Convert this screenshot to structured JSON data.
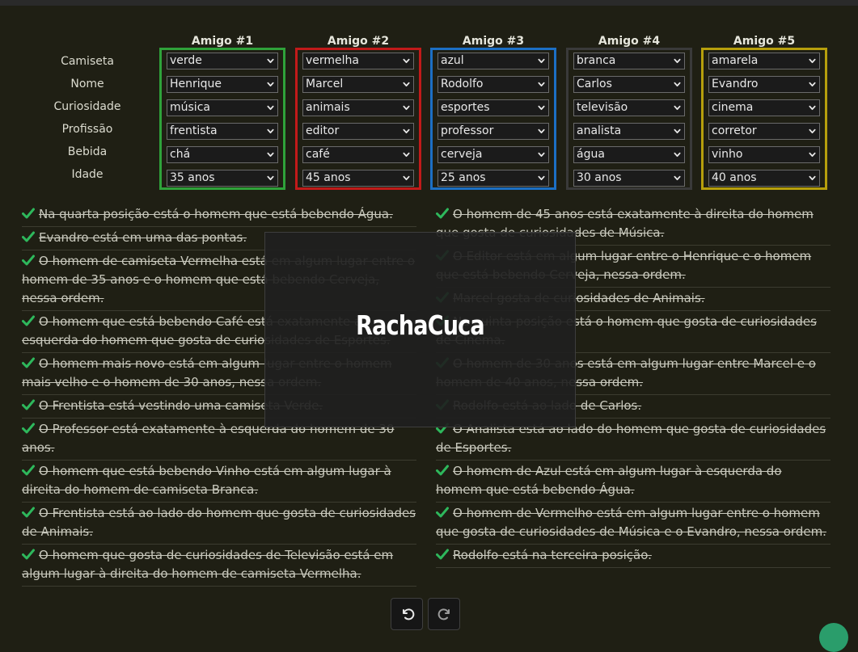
{
  "rows": [
    "Camiseta",
    "Nome",
    "Curiosidade",
    "Profissão",
    "Bebida",
    "Idade"
  ],
  "columns": [
    {
      "title": "Amigo #1",
      "color": "#2fa23a",
      "values": [
        "verde",
        "Henrique",
        "música",
        "frentista",
        "chá",
        "35 anos"
      ]
    },
    {
      "title": "Amigo #2",
      "color": "#c11a1a",
      "values": [
        "vermelha",
        "Marcel",
        "animais",
        "editor",
        "café",
        "45 anos"
      ]
    },
    {
      "title": "Amigo #3",
      "color": "#1c6fc4",
      "values": [
        "azul",
        "Rodolfo",
        "esportes",
        "professor",
        "cerveja",
        "25 anos"
      ]
    },
    {
      "title": "Amigo #4",
      "color": "#3a3a3a",
      "values": [
        "branca",
        "Carlos",
        "televisão",
        "analista",
        "água",
        "30 anos"
      ]
    },
    {
      "title": "Amigo #5",
      "color": "#b69f0c",
      "values": [
        "amarela",
        "Evandro",
        "cinema",
        "corretor",
        "vinho",
        "40 anos"
      ]
    }
  ],
  "clues_left": [
    "Na quarta posição está o homem que está bebendo Água.",
    "Evandro está em uma das pontas.",
    "O homem de camiseta Vermelha está em algum lugar entre o homem de 35 anos e o homem que está bebendo Cerveja, nessa ordem.",
    "O homem que está bebendo Café está exatamente à esquerda do homem que gosta de curiosidades de Esportes.",
    "O homem mais novo está em algum lugar entre o homem mais velho e o homem de 30 anos, nessa ordem.",
    "O Frentista está vestindo uma camiseta Verde.",
    "O Professor está exatamente à esquerda do homem de 30 anos.",
    "O homem que está bebendo Vinho está em algum lugar à direita do homem de camiseta Branca.",
    "O Frentista está ao lado do homem que gosta de curiosidades de Animais.",
    "O homem que gosta de curiosidades de Televisão está em algum lugar à direita do homem de camiseta Vermelha."
  ],
  "clues_right": [
    "O homem de 45 anos está exatamente à direita do homem que gosta de curiosidades de Música.",
    "O Editor está em algum lugar entre o Henrique e o homem que está bebendo Cerveja, nessa ordem.",
    "Marcel gosta de curiosidades de Animais.",
    "Na quinta posição está o homem que gosta de curiosidades de Cinema.",
    "O homem de 30 anos está em algum lugar entre Marcel e o homem de 40 anos, nessa ordem.",
    "Rodolfo está ao lado de Carlos.",
    "O Analista está ao lado do homem que gosta de curiosidades de Esportes.",
    "O homem de Azul está em algum lugar à esquerda do homem que está bebendo Água.",
    "O homem de Vermelho está em algum lugar entre o homem que gosta de curiosidades de Música e o Evandro, nessa ordem.",
    "Rodolfo está na terceira posição."
  ],
  "logo": "RachaCuca",
  "icons": {
    "check": "check-icon",
    "undo": "undo-icon",
    "redo": "redo-icon",
    "chevron": "chevron-down-icon"
  },
  "check_color": "#2eb85c"
}
